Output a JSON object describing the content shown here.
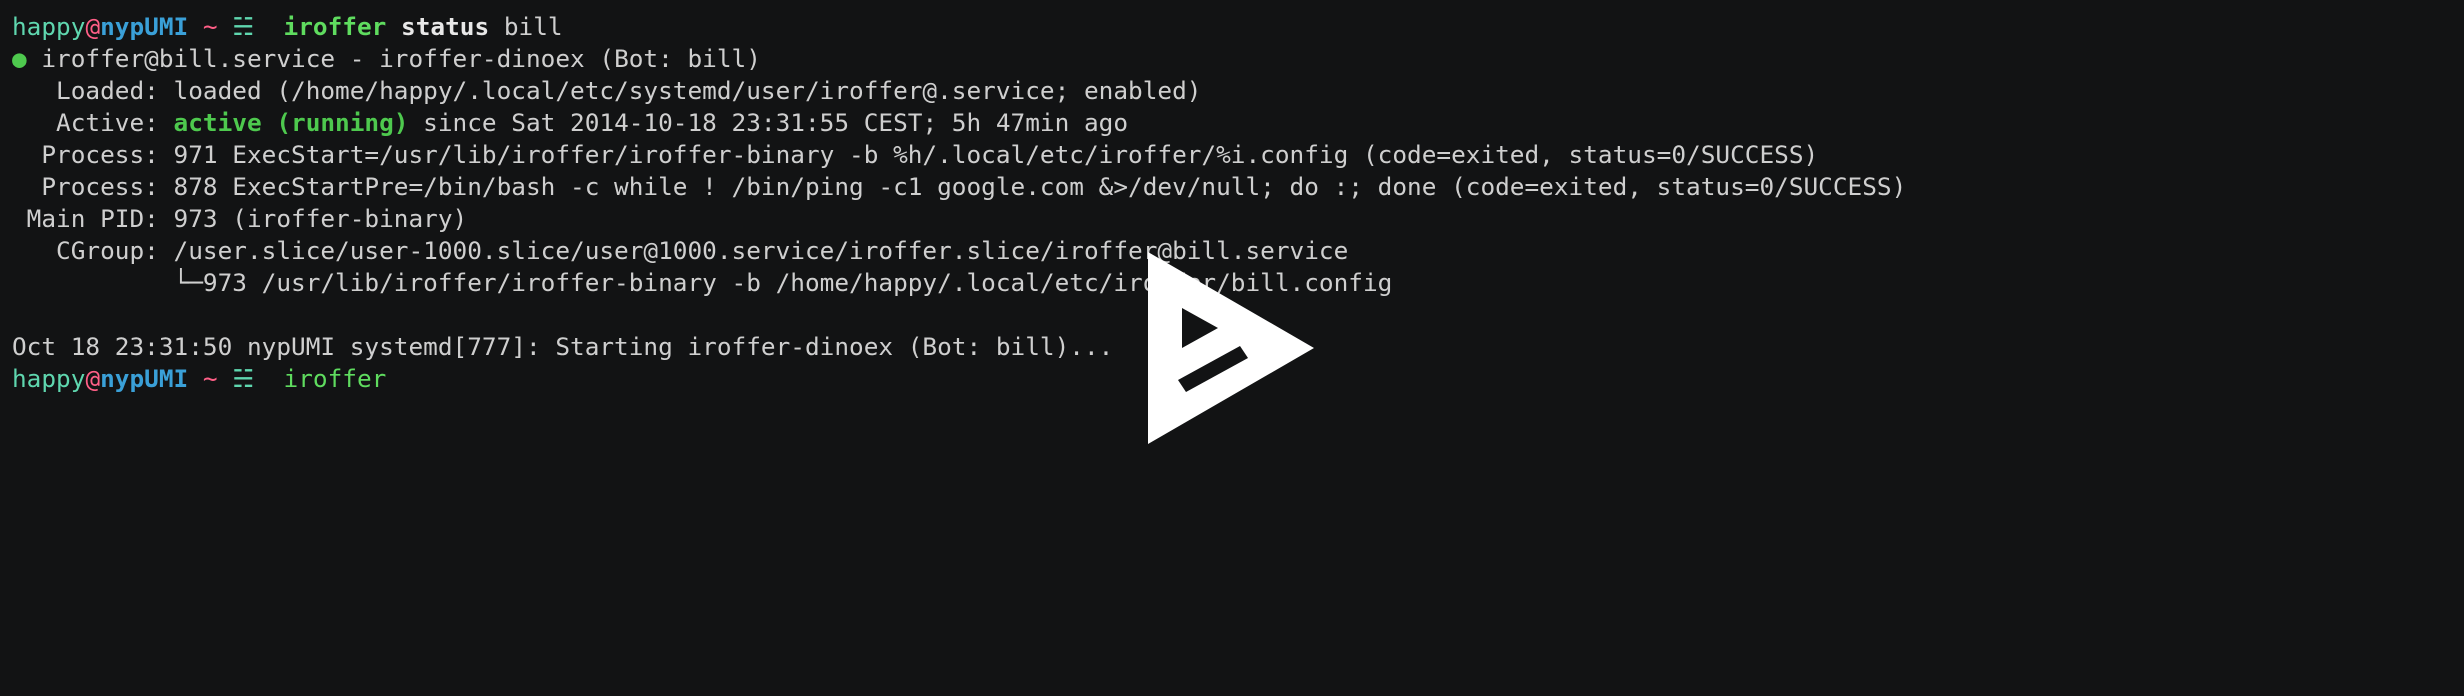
{
  "prompt": {
    "user": "happy",
    "at": "@",
    "host": "nypUMI",
    "tilde": " ~ ",
    "icon": "☵"
  },
  "command1": {
    "program": "iroffer",
    "subcommand": "status",
    "argument": "bill"
  },
  "status": {
    "bullet": "●",
    "unit_line": " iroffer@bill.service - iroffer-dinoex (Bot: bill)",
    "loaded_line": "   Loaded: loaded (/home/happy/.local/etc/systemd/user/iroffer@.service; enabled)",
    "active_label": "   Active: ",
    "active_state": "active (running)",
    "active_since": " since Sat 2014-10-18 23:31:55 CEST; 5h 47min ago",
    "process1_line": "  Process: 971 ExecStart=/usr/lib/iroffer/iroffer-binary -b %h/.local/etc/iroffer/%i.config (code=exited, status=0/SUCCESS)",
    "process2_line": "  Process: 878 ExecStartPre=/bin/bash -c while ! /bin/ping -c1 google.com &>/dev/null; do :; done (code=exited, status=0/SUCCESS)",
    "mainpid_line": " Main PID: 973 (iroffer-binary)",
    "cgroup_line": "   CGroup: /user.slice/user-1000.slice/user@1000.service/iroffer.slice/iroffer@bill.service",
    "cgroup_child_line": "           └─973 /usr/lib/iroffer/iroffer-binary -b /home/happy/.local/etc/iroffer/bill.config"
  },
  "log_line": "Oct 18 23:31:50 nypUMI systemd[777]: Starting iroffer-dinoex (Bot: bill)...",
  "command2": {
    "typed": "iroffer"
  },
  "overlay": {
    "icon": "asciinema-play-icon",
    "color": "#ffffff"
  }
}
